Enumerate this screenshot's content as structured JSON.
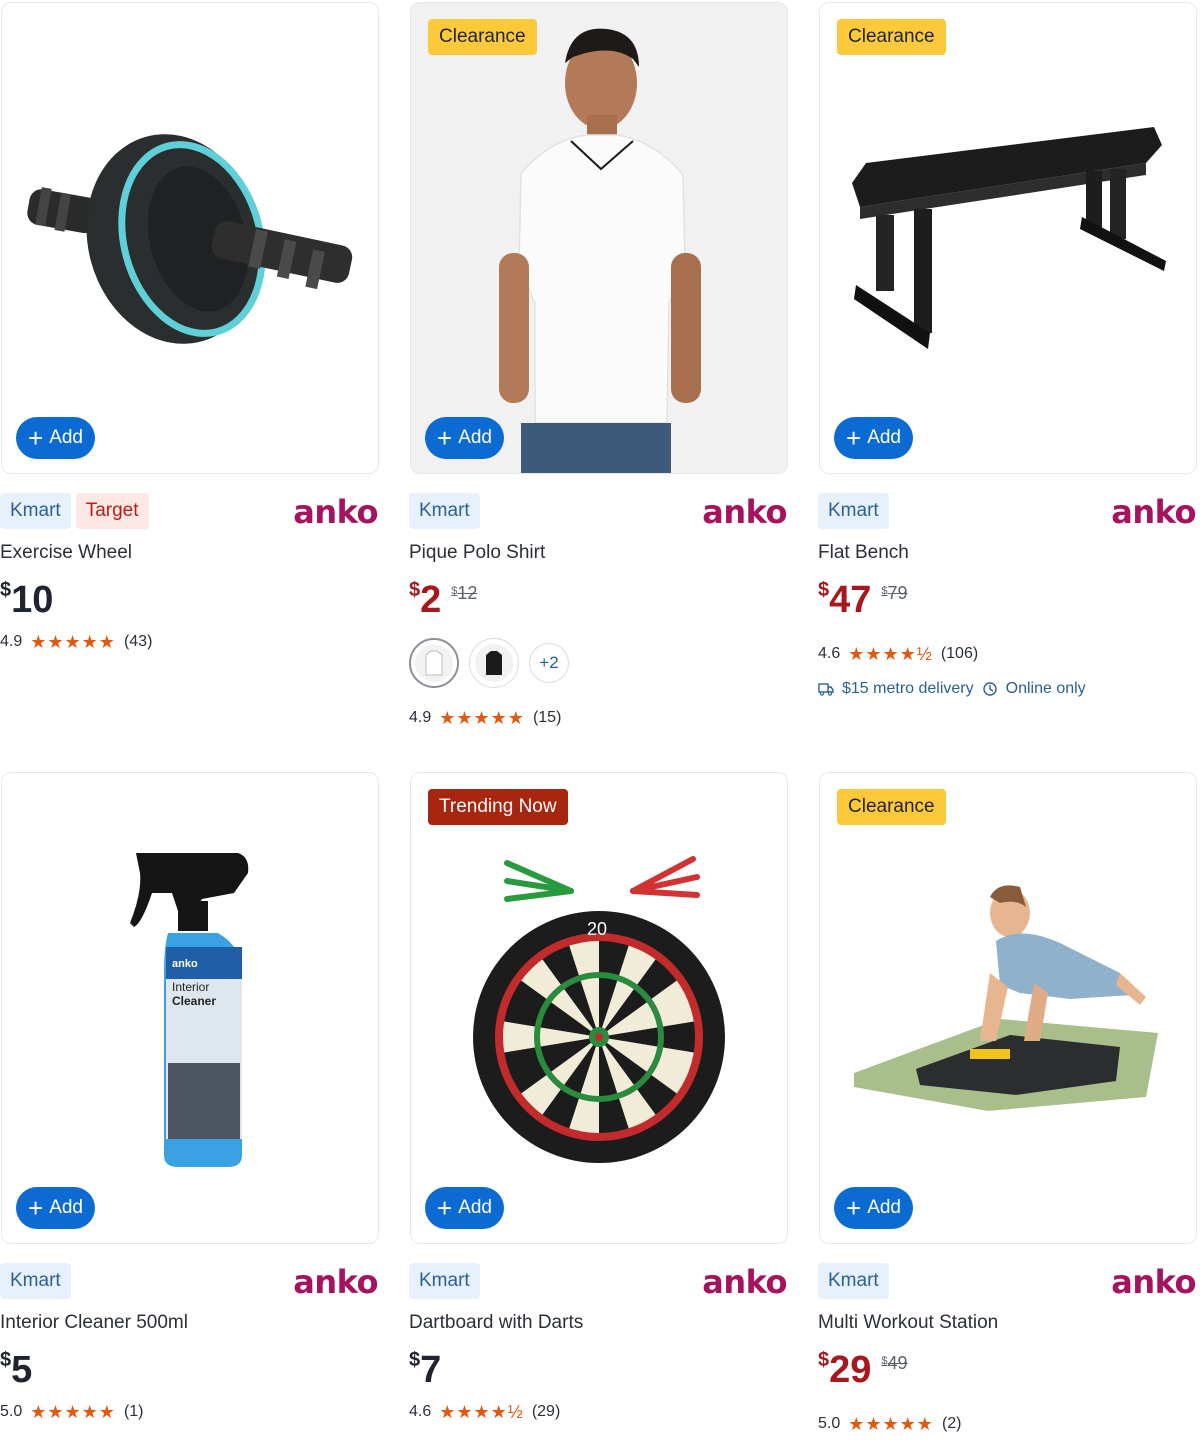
{
  "products": [
    {
      "badge": "",
      "add_label": "Add",
      "tags": [
        "Kmart",
        "Target"
      ],
      "brand": "anko",
      "title": "Exercise Wheel",
      "price": "10",
      "was": "",
      "rating": "4.9",
      "stars": "★★★★★",
      "reviews": "(43)",
      "swatch_more": "",
      "delivery": "",
      "online": ""
    },
    {
      "badge": "Clearance",
      "add_label": "Add",
      "tags": [
        "Kmart"
      ],
      "brand": "anko",
      "title": "Pique Polo Shirt",
      "price": "2",
      "was": "12",
      "rating": "4.9",
      "stars": "★★★★★",
      "reviews": "(15)",
      "swatch_more": "+2",
      "delivery": "",
      "online": ""
    },
    {
      "badge": "Clearance",
      "add_label": "Add",
      "tags": [
        "Kmart"
      ],
      "brand": "anko",
      "title": "Flat Bench",
      "price": "47",
      "was": "79",
      "rating": "4.6",
      "stars": "★★★★½",
      "reviews": "(106)",
      "swatch_more": "",
      "delivery": "$15 metro delivery",
      "online": "Online only"
    },
    {
      "badge": "",
      "add_label": "Add",
      "tags": [
        "Kmart"
      ],
      "brand": "anko",
      "title": "Interior Cleaner 500ml",
      "price": "5",
      "was": "",
      "rating": "5.0",
      "stars": "★★★★★",
      "reviews": "(1)",
      "swatch_more": "",
      "delivery": "",
      "online": ""
    },
    {
      "badge": "Trending Now",
      "add_label": "Add",
      "tags": [
        "Kmart"
      ],
      "brand": "anko",
      "title": "Dartboard with Darts",
      "price": "7",
      "was": "",
      "rating": "4.6",
      "stars": "★★★★½",
      "reviews": "(29)",
      "swatch_more": "",
      "delivery": "",
      "online": ""
    },
    {
      "badge": "Clearance",
      "add_label": "Add",
      "tags": [
        "Kmart"
      ],
      "brand": "anko",
      "title": "Multi Workout Station",
      "price": "29",
      "was": "49",
      "rating": "5.0",
      "stars": "★★★★★",
      "reviews": "(2)",
      "swatch_more": "",
      "delivery": "",
      "online": ""
    }
  ],
  "currency_symbol": "$",
  "colors": {
    "add_button": "#0b6bd3",
    "clearance_badge": "#fcc93a",
    "trending_badge": "#a8260f",
    "sale_price": "#a8171d",
    "brand": "#a6125e",
    "stars": "#e3580f"
  }
}
